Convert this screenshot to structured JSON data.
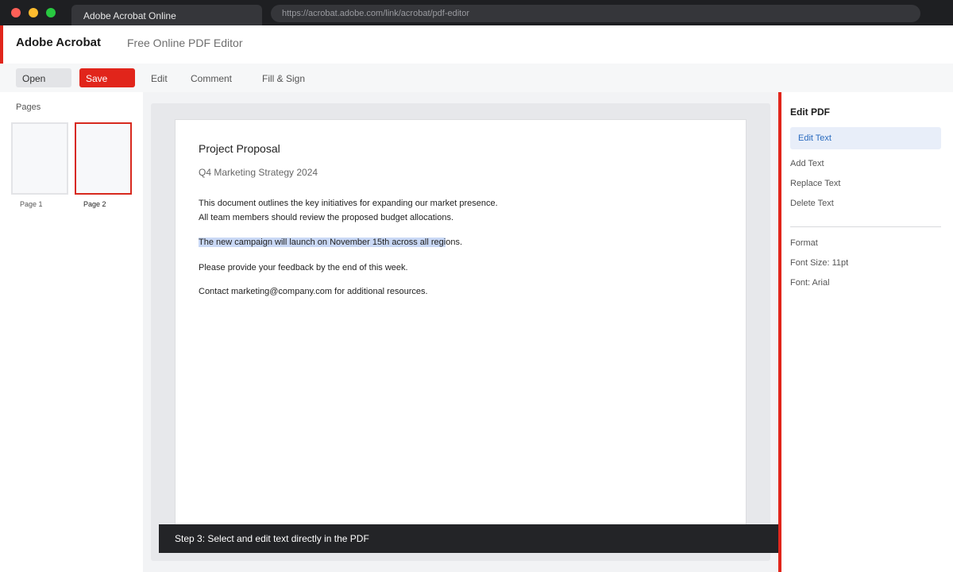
{
  "browser": {
    "tab_title": "Adobe Acrobat Online",
    "url": "https://acrobat.adobe.com/link/acrobat/pdf-editor"
  },
  "app": {
    "brand": "Adobe Acrobat",
    "subtitle": "Free Online PDF Editor",
    "accent_color": "#e1251b"
  },
  "toolbar": {
    "open_label": "Open",
    "save_label": "Save",
    "edit_label": "Edit",
    "comment_label": "Comment",
    "fill_sign_label": "Fill & Sign"
  },
  "sidebar": {
    "title": "Pages",
    "pages": [
      {
        "label": "Page 1",
        "selected": false
      },
      {
        "label": "Page 2",
        "selected": true
      }
    ]
  },
  "document": {
    "title": "Project Proposal",
    "subtitle": "Q4 Marketing Strategy 2024",
    "para1_line1": "This document outlines the key initiatives for expanding our market presence.",
    "para1_line2": "All team members should review the proposed budget allocations.",
    "highlighted_text": "The new campaign will launch on November 15th across all regi",
    "highlight_rest": "ons.",
    "para3": "Please provide your feedback by the end of this week.",
    "para4": "Contact marketing@company.com for additional resources."
  },
  "step_banner": "Step 3: Select and edit text directly in the PDF",
  "right_panel": {
    "title": "Edit PDF",
    "active_item": "Edit Text",
    "items": [
      "Add Text",
      "Replace Text",
      "Delete Text"
    ],
    "format_heading": "Format",
    "font_size": "Font Size: 11pt",
    "font": "Font: Arial"
  }
}
